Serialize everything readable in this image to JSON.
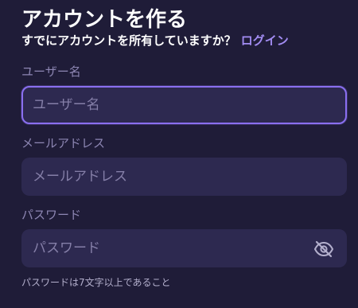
{
  "header": {
    "title": "アカウントを作る",
    "subtitle": "すでにアカウントを所有していますか？",
    "login_link": "ログイン"
  },
  "form": {
    "username": {
      "label": "ユーザー名",
      "placeholder": "ユーザー名",
      "value": ""
    },
    "email": {
      "label": "メールアドレス",
      "placeholder": "メールアドレス",
      "value": ""
    },
    "password": {
      "label": "パスワード",
      "placeholder": "パスワード",
      "value": "",
      "toggle_icon": "eye-off-icon",
      "hint": "パスワードは7文字以上であること"
    }
  },
  "colors": {
    "background": "#1f1c38",
    "field_background": "#2d2950",
    "accent": "#8a6ff0",
    "link": "#a28cf2",
    "label": "#8d86b3"
  }
}
